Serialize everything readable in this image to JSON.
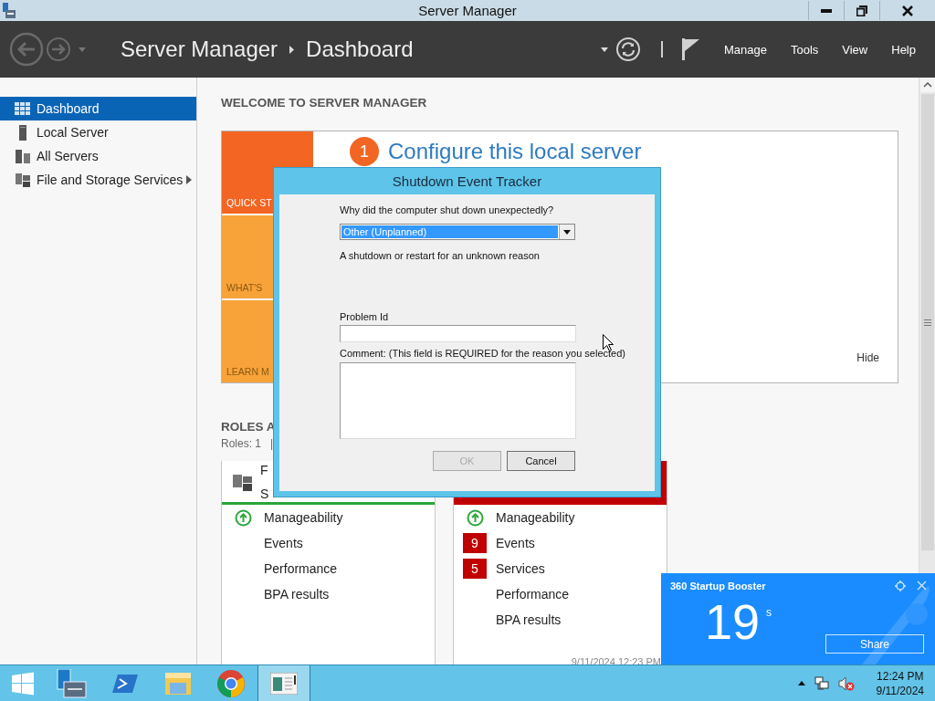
{
  "window": {
    "title": "Server Manager"
  },
  "header": {
    "app": "Server Manager",
    "page": "Dashboard",
    "menus": [
      "Manage",
      "Tools",
      "View",
      "Help"
    ]
  },
  "sidebar": {
    "items": [
      {
        "label": "Dashboard",
        "selected": true,
        "expandable": false
      },
      {
        "label": "Local Server",
        "selected": false,
        "expandable": false
      },
      {
        "label": "All Servers",
        "selected": false,
        "expandable": false
      },
      {
        "label": "File and Storage Services",
        "selected": false,
        "expandable": true
      }
    ]
  },
  "welcome": {
    "heading": "WELCOME TO SERVER MANAGER",
    "tiles": [
      {
        "label": "QUICK ST",
        "color": "#f26522"
      },
      {
        "label": "WHAT'S",
        "color": "#f8a23a"
      },
      {
        "label": "LEARN M",
        "color": "#f8a23a"
      }
    ],
    "step_number": "1",
    "step_title": "Configure this local server",
    "hide": "Hide"
  },
  "roles": {
    "heading": "ROLES A",
    "summary": "Roles: 1   |",
    "cards": [
      {
        "color": "#2aa63a",
        "alert": false,
        "title": [
          "F",
          "S"
        ],
        "rows": [
          {
            "kind": "ok",
            "label": "Manageability"
          },
          {
            "kind": "plain",
            "label": "Events"
          },
          {
            "kind": "plain",
            "label": "Performance"
          },
          {
            "kind": "plain",
            "label": "BPA results"
          }
        ]
      },
      {
        "color": "#c00000",
        "alert": true,
        "rows": [
          {
            "kind": "ok",
            "label": "Manageability"
          },
          {
            "kind": "count",
            "count": "9",
            "label": "Events"
          },
          {
            "kind": "count",
            "count": "5",
            "label": "Services"
          },
          {
            "kind": "plain",
            "label": "Performance"
          },
          {
            "kind": "plain",
            "label": "BPA results"
          }
        ],
        "timestamp": "9/11/2024 12:23 PM"
      }
    ]
  },
  "dialog": {
    "title": "Shutdown Event Tracker",
    "question": "Why did the computer shut down unexpectedly?",
    "reason": "Other (Unplanned)",
    "description": "A shutdown or restart for an unknown reason",
    "problem_label": "Problem Id",
    "comment_label": "Comment: (This field is REQUIRED for the reason you selected)",
    "buttons": [
      {
        "label": "OK",
        "disabled": true
      },
      {
        "label": "Cancel",
        "disabled": false
      }
    ]
  },
  "popup": {
    "title": "360 Startup Booster",
    "value": "19",
    "unit": "s",
    "button": "Share"
  },
  "taskbar": {
    "apps": [
      {
        "selected": false
      },
      {
        "selected": false
      },
      {
        "selected": false
      },
      {
        "selected": false
      },
      {
        "selected": true
      }
    ]
  },
  "tray": {
    "time": "12:24 PM",
    "date": "9/11/2024"
  }
}
